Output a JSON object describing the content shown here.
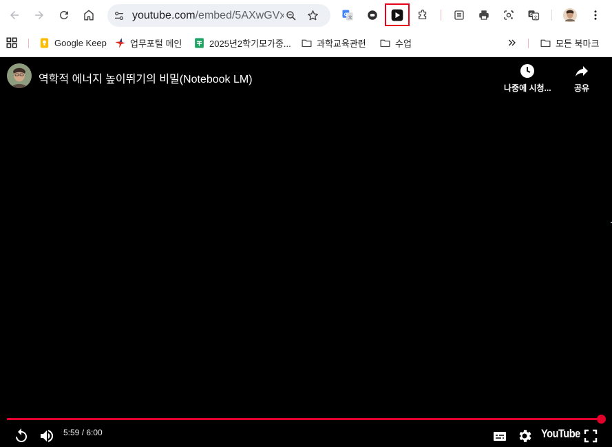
{
  "browser": {
    "url_main": "youtube.com",
    "url_path": "/embed/5AXwGVx...",
    "bookmarks": [
      {
        "label": "Google Keep"
      },
      {
        "label": "업무포털 메인"
      },
      {
        "label": "2025년2학기모가중..."
      },
      {
        "label": "과학교육관련"
      },
      {
        "label": "수업"
      }
    ],
    "all_bookmarks_label": "모든 북마크"
  },
  "player": {
    "title": "역학적 에너지 높이뛰기의 비밀(Notebook LM)",
    "watch_later_label": "나중에 시청...",
    "share_label": "공유",
    "time_display": "5:59 / 6:00",
    "progress": 0.997,
    "logo_text": "YouTube"
  },
  "colors": {
    "progress": "#e3002b",
    "highlight_border": "#e8001a"
  }
}
